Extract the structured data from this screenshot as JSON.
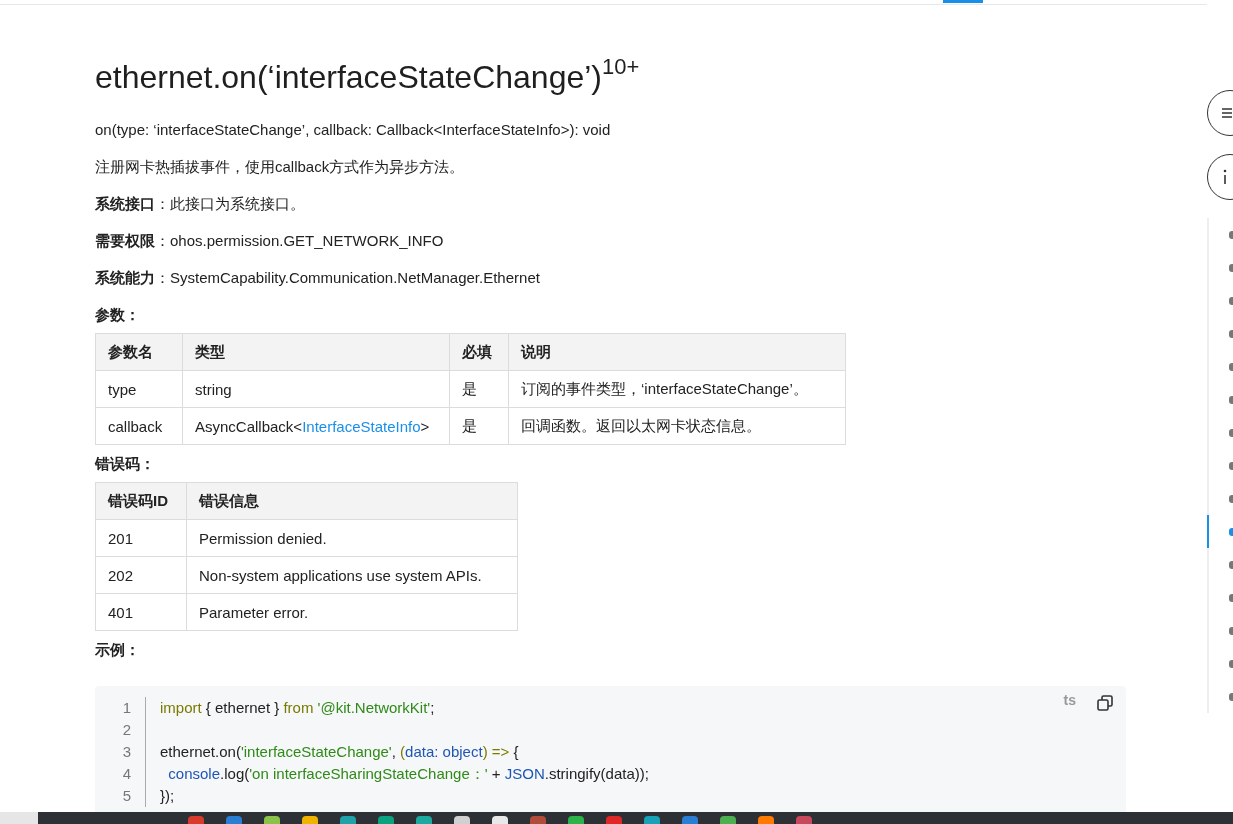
{
  "title": "ethernet.on(‘interfaceStateChange’)$^{10+}$",
  "lines": [
    {
      "kind": "plain",
      "text": "on(type: ‘interfaceStateChange’, callback: Callback<InterfaceStateInfo>): void"
    },
    {
      "kind": "plain",
      "text": "注册网卡热插拔事件，使用callback方式作为异步方法。"
    },
    {
      "kind": "field",
      "label": "系统接口",
      "text": "：此接口为系统接口。"
    },
    {
      "kind": "field",
      "label": "需要权限",
      "text": "：ohos.permission.GET_NETWORK_INFO"
    },
    {
      "kind": "field",
      "label": "系统能力",
      "text": "：SystemCapability.Communication.NetManager.Ethernet"
    }
  ],
  "params": {
    "heading": "参数：",
    "columns": [
      "参数名",
      "类型",
      "必填",
      "说明"
    ],
    "rows": [
      [
        {
          "text": "type"
        },
        {
          "text": "string"
        },
        {
          "text": "是"
        },
        {
          "text": "订阅的事件类型，‘interfaceStateChange’。"
        }
      ],
      [
        {
          "text": "callback"
        },
        {
          "before": "AsyncCallback<",
          "link": "InterfaceStateInfo",
          "after": ">"
        },
        {
          "text": "是"
        },
        {
          "text": "回调函数。返回以太网卡状态信息。"
        }
      ]
    ]
  },
  "errors": {
    "heading": "错误码：",
    "columns": [
      "错误码ID",
      "错误信息"
    ],
    "rows": [
      [
        {
          "text": "201"
        },
        {
          "text": "Permission denied."
        }
      ],
      [
        {
          "text": "202"
        },
        {
          "text": "Non-system applications use system APIs."
        }
      ],
      [
        {
          "text": "401"
        },
        {
          "text": "Parameter error."
        }
      ]
    ]
  },
  "example": {
    "heading": "示例：",
    "language": "ts",
    "code": [
      {
        "number": "1",
        "tokens": [
          {
            "kind": "keyword",
            "text": "import"
          },
          {
            "kind": "plain",
            "text": " { ethernet } "
          },
          {
            "kind": "keyword",
            "text": "from "
          },
          {
            "kind": "string",
            "text": "'@kit.NetworkKit'"
          },
          {
            "kind": "plain",
            "text": ";"
          }
        ]
      },
      {
        "number": "2"
      },
      {
        "number": "3",
        "tokens": [
          {
            "kind": "plain",
            "text": "ethernet.on("
          },
          {
            "kind": "string",
            "text": "'interfaceStateChange'"
          },
          {
            "kind": "plain",
            "text": ", "
          },
          {
            "kind": "keyword",
            "text": "("
          },
          {
            "kind": "type",
            "text": "data: object"
          },
          {
            "kind": "keyword",
            "text": ") =>"
          },
          {
            "kind": "plain",
            "text": " {"
          }
        ]
      },
      {
        "number": "4",
        "tokens": [
          {
            "kind": "type",
            "text": "  console"
          },
          {
            "kind": "plain",
            "text": ".log("
          },
          {
            "kind": "string",
            "text": "'on interfaceSharingStateChange：'"
          },
          {
            "kind": "plain",
            "text": " + "
          },
          {
            "kind": "type",
            "text": "JSON"
          },
          {
            "kind": "plain",
            "text": ".stringify(data));"
          }
        ]
      },
      {
        "number": "5",
        "tokens": [
          {
            "kind": "plain",
            "text": "});"
          }
        ]
      }
    ]
  },
  "toc": [
    {
      "selected": false
    },
    {
      "selected": false
    },
    {
      "selected": false
    },
    {
      "selected": false
    },
    {
      "selected": false
    },
    {
      "selected": false
    },
    {
      "selected": false
    },
    {
      "selected": false
    },
    {
      "selected": false
    },
    {
      "selected": true
    },
    {
      "selected": false
    },
    {
      "selected": false
    },
    {
      "selected": false
    },
    {
      "selected": false
    },
    {
      "selected": false
    }
  ]
}
